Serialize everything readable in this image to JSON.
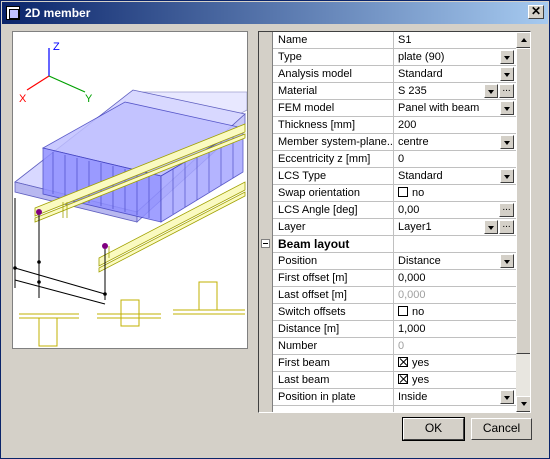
{
  "window": {
    "title": "2D member",
    "close_glyph": "✕"
  },
  "axes": {
    "x": "X",
    "y": "Y",
    "z": "Z"
  },
  "properties": [
    {
      "label": "Name",
      "value": "S1",
      "control": "text"
    },
    {
      "label": "Type",
      "value": "plate (90)",
      "control": "dropdown"
    },
    {
      "label": "Analysis model",
      "value": "Standard",
      "control": "dropdown"
    },
    {
      "label": "Material",
      "value": "S 235",
      "control": "dropdown-ellipsis"
    },
    {
      "label": "FEM model",
      "value": "Panel with beam",
      "control": "dropdown"
    },
    {
      "label": "Thickness [mm]",
      "value": "200",
      "control": "text"
    },
    {
      "label": "Member system-plane...",
      "value": "centre",
      "control": "dropdown"
    },
    {
      "label": "Eccentricity z [mm]",
      "value": "0",
      "control": "text"
    },
    {
      "label": "LCS Type",
      "value": "Standard",
      "control": "dropdown"
    },
    {
      "label": "Swap orientation",
      "value": "no",
      "control": "checkbox",
      "checked": false
    },
    {
      "label": "LCS Angle [deg]",
      "value": "0,00",
      "control": "ellipsis"
    },
    {
      "label": "Layer",
      "value": "Layer1",
      "control": "dropdown-ellipsis"
    },
    {
      "label": "Beam layout",
      "value": "",
      "control": "section"
    },
    {
      "label": "Position",
      "value": "Distance",
      "control": "dropdown"
    },
    {
      "label": "First offset [m]",
      "value": "0,000",
      "control": "text"
    },
    {
      "label": "Last offset [m]",
      "value": "0,000",
      "control": "text-disabled"
    },
    {
      "label": "Switch offsets",
      "value": "no",
      "control": "checkbox",
      "checked": false
    },
    {
      "label": "Distance [m]",
      "value": "1,000",
      "control": "text"
    },
    {
      "label": "Number",
      "value": "0",
      "control": "text-disabled"
    },
    {
      "label": "First beam",
      "value": "yes",
      "control": "checkbox",
      "checked": true
    },
    {
      "label": "Last beam",
      "value": "yes",
      "control": "checkbox",
      "checked": true
    },
    {
      "label": "Position in plate",
      "value": "Inside",
      "control": "dropdown"
    },
    {
      "label": "",
      "value": "",
      "control": "text"
    }
  ],
  "buttons": {
    "ok": "OK",
    "cancel": "Cancel"
  },
  "ellipsis_glyph": "...",
  "colors": {
    "title_start": "#0a246a",
    "title_end": "#a6caf0",
    "plate": "#8080ff",
    "beam": "#e0e070",
    "node": "#800080"
  }
}
